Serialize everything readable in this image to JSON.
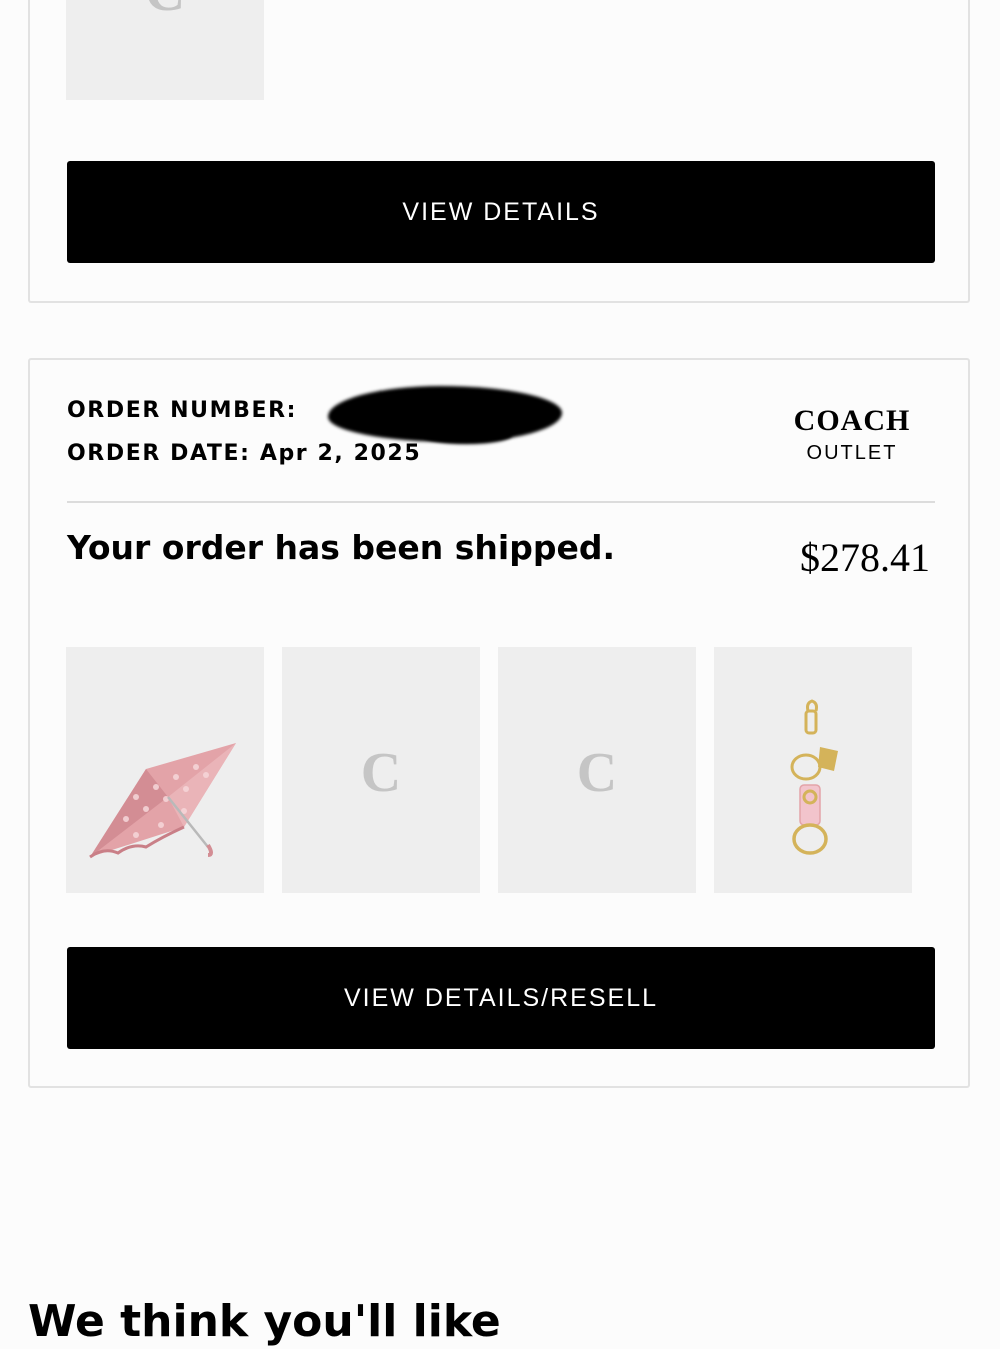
{
  "previous_order": {
    "item_icon": "coach-c-placeholder",
    "button_label": "VIEW DETAILS"
  },
  "order": {
    "number_label": "ORDER NUMBER:",
    "date_label": "ORDER DATE:",
    "date_value": "Apr 2, 2025",
    "brand_name": "COACH",
    "brand_sub": "OUTLET",
    "status": "Your order has been shipped.",
    "total": "$278.41",
    "items": [
      {
        "icon": "pink-umbrella"
      },
      {
        "icon": "coach-c-placeholder"
      },
      {
        "icon": "coach-c-placeholder"
      },
      {
        "icon": "pink-keychain"
      }
    ],
    "button_label": "VIEW DETAILS/RESELL"
  },
  "recommendations": {
    "heading": "We think you'll like"
  },
  "colors": {
    "button_bg": "#000000",
    "button_text": "#ffffff",
    "thumb_bg": "#eeeeee",
    "card_border": "#e2e2e2",
    "umbrella_pink": "#e3a3a8",
    "charm_gold": "#d4b35a",
    "charm_pink": "#f2c4cc"
  }
}
